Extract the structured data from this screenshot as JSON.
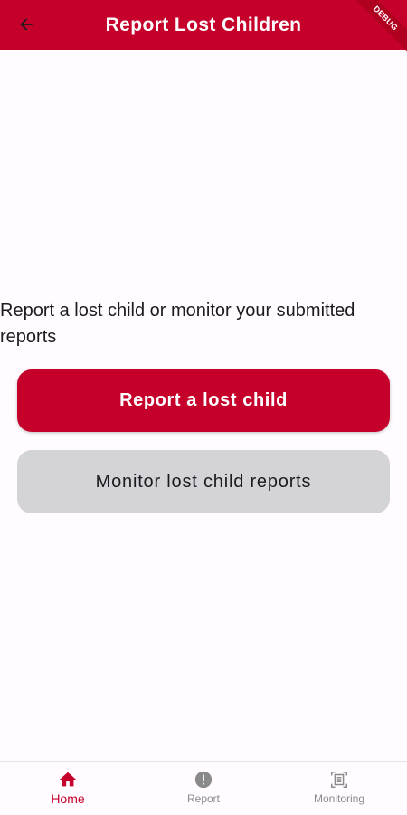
{
  "app_bar": {
    "title": "Report Lost Children",
    "back_icon": "arrow-back-icon",
    "debug_banner": "DEBUG",
    "color": "#c4002b"
  },
  "main": {
    "prompt": "Report a lost child or monitor your submitted reports",
    "primary_button": "Report a lost child",
    "secondary_button": "Monitor lost child reports"
  },
  "bottom_nav": {
    "items": [
      {
        "label": "Home",
        "icon": "home-icon",
        "active": true
      },
      {
        "label": "Report",
        "icon": "alert-icon",
        "active": false
      },
      {
        "label": "Monitoring",
        "icon": "document-scan-icon",
        "active": false
      }
    ],
    "active_color": "#c4002b",
    "inactive_color": "#8a8a8a"
  }
}
